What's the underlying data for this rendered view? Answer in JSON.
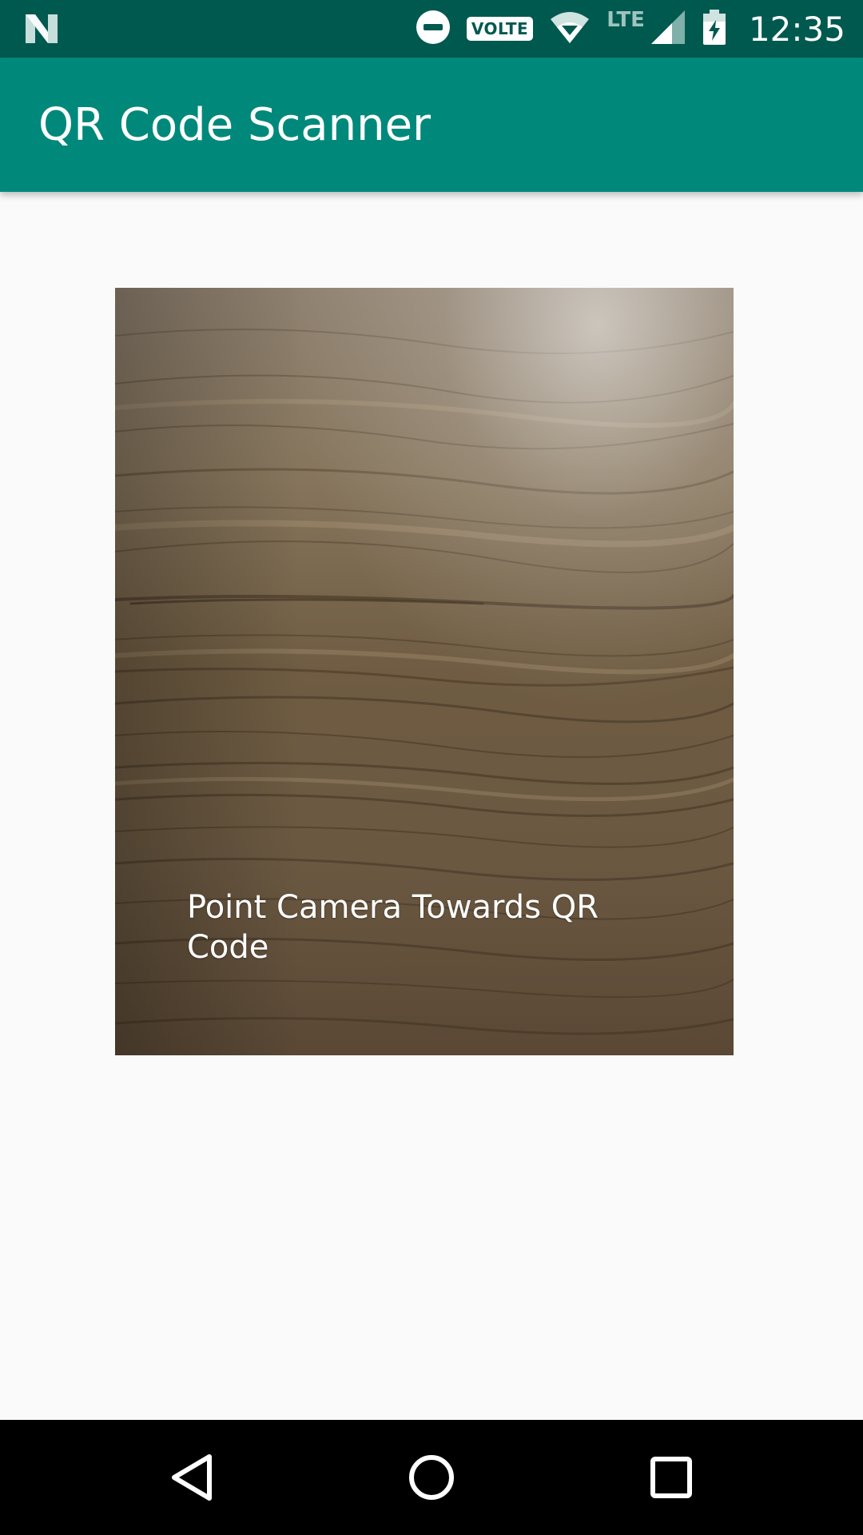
{
  "status_bar": {
    "network_type": "VOLTE",
    "data_type": "LTE",
    "time": "12:35",
    "icons": [
      "notification-n-icon",
      "do-not-disturb-icon",
      "volte-badge",
      "wifi-icon",
      "lte-label",
      "cell-signal-icon",
      "battery-charging-icon"
    ]
  },
  "app_bar": {
    "title": "QR Code Scanner"
  },
  "camera_preview": {
    "hint_text": "Point Camera Towards QR Code"
  },
  "nav_bar": {
    "icons": [
      "back-icon",
      "home-icon",
      "recents-icon"
    ]
  },
  "colors": {
    "status_bar": "#00594f",
    "app_bar": "#00897b",
    "background": "#fafafa",
    "nav_bar": "#000000"
  }
}
